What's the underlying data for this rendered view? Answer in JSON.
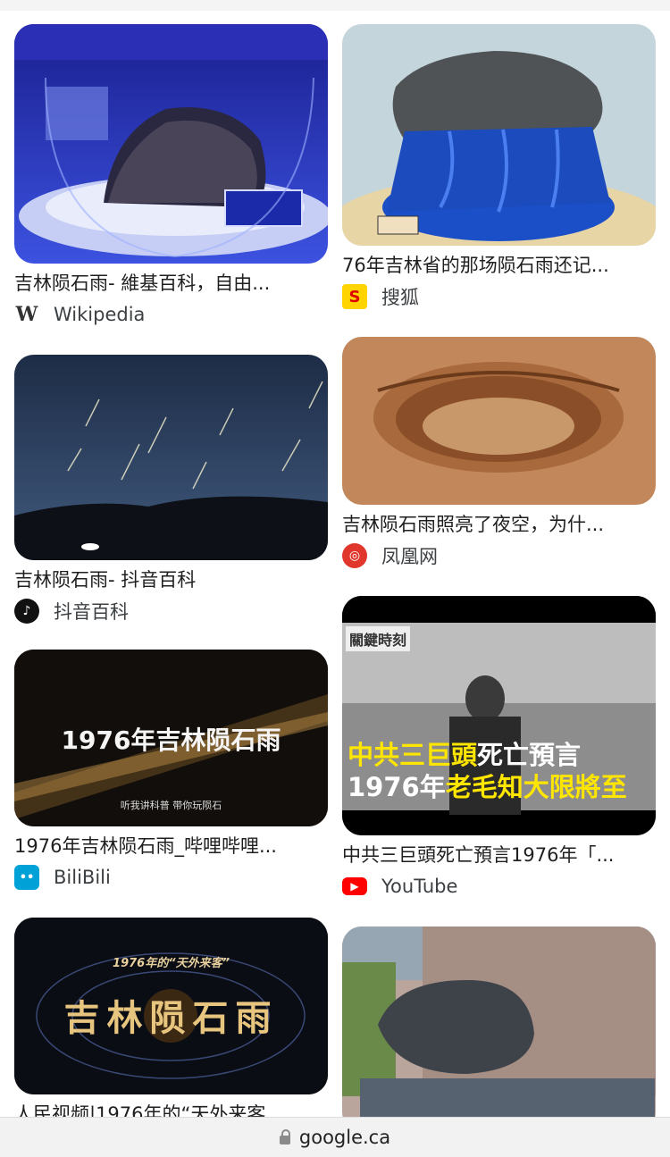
{
  "results": {
    "left": [
      {
        "caption": "吉林陨石雨- 維基百科，自由...",
        "source": "Wikipedia",
        "icon": "wikipedia-icon",
        "overlay": ""
      },
      {
        "caption": "吉林陨石雨- 抖音百科",
        "source": "抖音百科",
        "icon": "douyin-icon",
        "overlay": ""
      },
      {
        "caption": "1976年吉林陨石雨_哔哩哔哩...",
        "source": "BiliBili",
        "icon": "bilibili-icon",
        "overlay": "1976年吉林陨石雨",
        "overlay_sub": "听我讲科普 带你玩陨石"
      },
      {
        "caption": "人民视频|1976年的“天外来客",
        "source": "",
        "icon": "",
        "overlay": "吉林陨石雨",
        "overlay_sub": "1976年的“天外来客”"
      }
    ],
    "right": [
      {
        "caption": "76年吉林省的那场陨石雨还记...",
        "source": "搜狐",
        "icon": "sohu-icon",
        "overlay": ""
      },
      {
        "caption": "吉林陨石雨照亮了夜空，为什...",
        "source": "凤凰网",
        "icon": "ifeng-icon",
        "overlay": ""
      },
      {
        "caption": "中共三巨頭死亡預言1976年「...",
        "source": "YouTube",
        "icon": "youtube-icon",
        "overlay": "",
        "overlay_line1_a": "中共三巨頭",
        "overlay_line1_b": "死亡預言",
        "overlay_line2_a": "1976年",
        "overlay_line2_b": "老毛知大限將至",
        "overlay_logo": "關鍵時刻"
      },
      {
        "caption": "",
        "source": "",
        "icon": "",
        "overlay": ""
      }
    ]
  },
  "urlbar": {
    "domain": "google.ca"
  },
  "colors": {
    "youtube_red": "#ff0000",
    "bilibili_blue": "#00a1d6",
    "sohu_yellow": "#ffd400",
    "ifeng_red": "#e0362c"
  }
}
